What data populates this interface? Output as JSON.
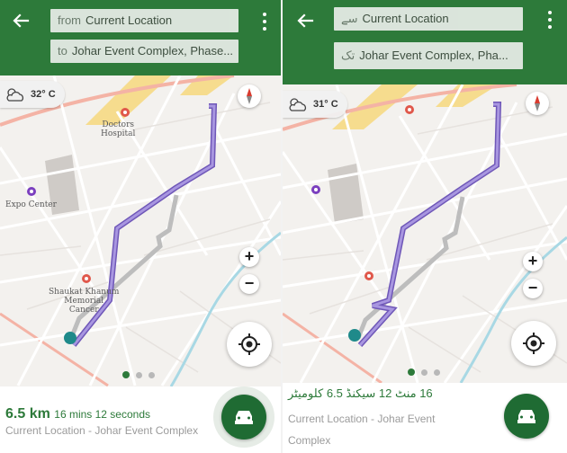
{
  "colors": {
    "bar": "#2d7a3a",
    "route": "#8a6ccf",
    "alt_route": "#bdbdbd",
    "poi": "#e0584b",
    "start": "#1f8a8a"
  },
  "left": {
    "from_prefix": "from",
    "from_value": "Current Location",
    "to_prefix": "to",
    "to_value": "Johar Event Complex, Phase...",
    "temperature": "32° C",
    "labels": {
      "doctors": "Doctors",
      "hospital": "Hospital",
      "expo": "Expo Center",
      "shaukat1": "Shaukat Khanum",
      "shaukat2": "Memorial",
      "shaukat3": "Cancer"
    },
    "distance": "6.5 km",
    "duration": "16 mins 12 seconds",
    "route_label": "Current Location - Johar Event Complex",
    "zoom_in": "+",
    "zoom_out": "−"
  },
  "right": {
    "from_prefix": "سے",
    "from_value": "Current Location",
    "to_prefix": "تک",
    "to_value": "Johar Event Complex, Pha...",
    "temperature": "31° C",
    "distance_duration": "16 منٹ 12 سیکنڈ 6.5 کلومیٹر",
    "route_label_line1": "Current Location - Johar Event",
    "route_label_line2": "Complex",
    "zoom_in": "+",
    "zoom_out": "−"
  },
  "pager": {
    "pages": 3,
    "current": 1
  },
  "icons": [
    "back-arrow-icon",
    "more-vert-icon",
    "weather-cloud-sun-icon",
    "compass-icon",
    "my-location-icon",
    "car-icon"
  ]
}
